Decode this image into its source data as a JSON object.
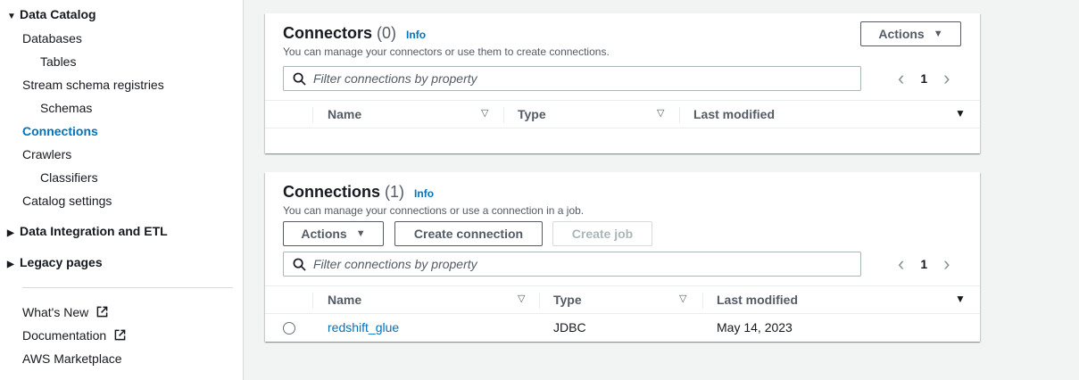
{
  "sidebar": {
    "data_catalog": "Data Catalog",
    "databases": "Databases",
    "tables": "Tables",
    "stream_schema_registries": "Stream schema registries",
    "schemas": "Schemas",
    "connections": "Connections",
    "crawlers": "Crawlers",
    "classifiers": "Classifiers",
    "catalog_settings": "Catalog settings",
    "data_integration": "Data Integration and ETL",
    "legacy_pages": "Legacy pages",
    "whats_new": "What's New",
    "documentation": "Documentation",
    "aws_marketplace": "AWS Marketplace"
  },
  "connectors": {
    "title": "Connectors",
    "count": "(0)",
    "info": "Info",
    "description": "You can manage your connectors or use them to create connections.",
    "actions_label": "Actions",
    "filter_placeholder": "Filter connections by property",
    "page": "1",
    "columns": [
      "Name",
      "Type",
      "Last modified"
    ]
  },
  "connections": {
    "title": "Connections",
    "count": "(1)",
    "info": "Info",
    "description": "You can manage your connections or use a connection in a job.",
    "actions_label": "Actions",
    "create_connection_label": "Create connection",
    "create_job_label": "Create job",
    "filter_placeholder": "Filter connections by property",
    "page": "1",
    "columns": [
      "Name",
      "Type",
      "Last modified"
    ],
    "rows": [
      {
        "name": "redshift_glue",
        "type": "JDBC",
        "last_modified": "May 14, 2023"
      }
    ]
  },
  "colors": {
    "accent_link": "#0073bb",
    "text_primary": "#16191f",
    "text_secondary": "#545b64",
    "page_bg": "#f2f3f3",
    "border": "#aab7b8"
  },
  "icons": {
    "expanded": "caret-down-icon",
    "collapsed": "caret-right-icon",
    "external": "external-link-icon",
    "search": "search-icon",
    "sort": "sort-icon"
  }
}
